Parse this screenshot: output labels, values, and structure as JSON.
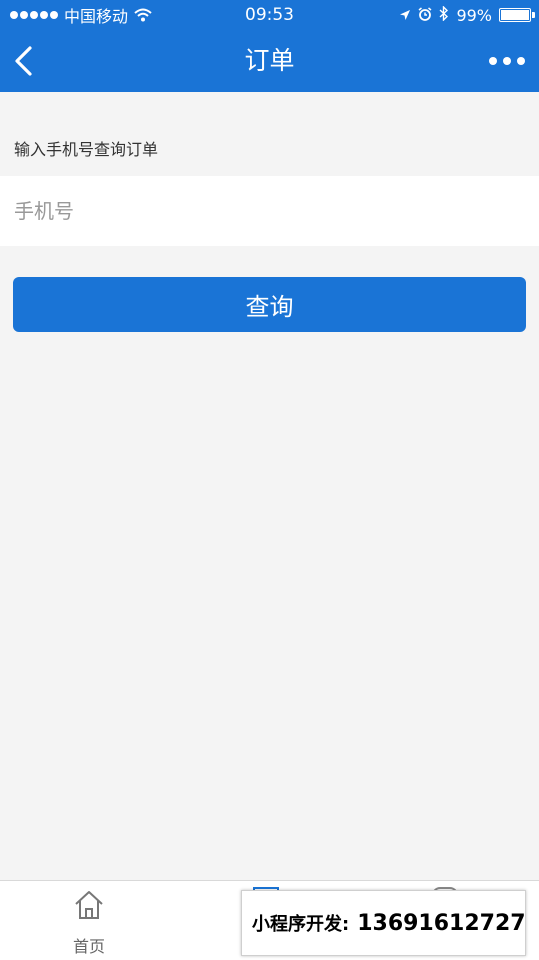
{
  "status_bar": {
    "carrier": "中国移动",
    "time": "09:53",
    "battery_percent": "99%",
    "icons": [
      "signal-dots-icon",
      "wifi-icon",
      "location-arrow-icon",
      "alarm-clock-icon",
      "bluetooth-icon",
      "battery-icon"
    ]
  },
  "nav": {
    "title": "订单",
    "back_icon": "chevron-left-icon",
    "more_icon": "more-dots-icon"
  },
  "form": {
    "section_label": "输入手机号查询订单",
    "phone_placeholder": "手机号",
    "phone_value": "",
    "search_label": "查询"
  },
  "tabbar": {
    "home_label": "首页",
    "home_icon": "home-icon"
  },
  "watermark": {
    "label": "小程序开发:",
    "phone": "13691612727"
  },
  "colors": {
    "primary": "#1a74d6",
    "background": "#f4f4f4",
    "surface": "#ffffff"
  }
}
